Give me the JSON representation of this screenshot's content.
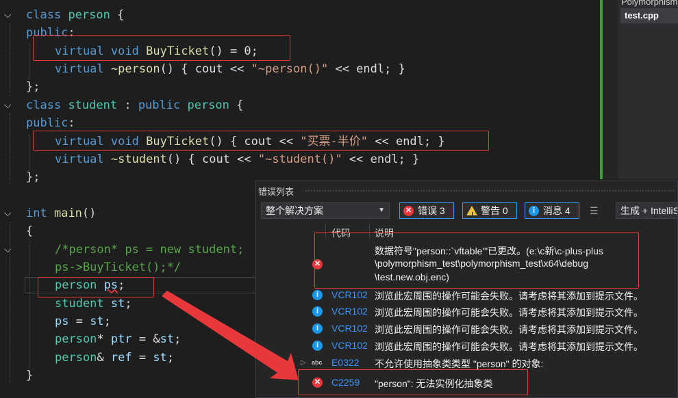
{
  "editor": {
    "lines": {
      "l1": {
        "kw": "class",
        "name": "person",
        "rest": " {"
      },
      "l2": {
        "kw": "public",
        "rest": ":"
      },
      "l3": {
        "virt": "virtual",
        "void": "void",
        "fn": "BuyTicket",
        "rest": "() = 0;"
      },
      "l4": {
        "virt": "virtual",
        "fn": "~person",
        "a": "() { cout << ",
        "str": "\"~person()\"",
        "b": " << endl; }"
      },
      "l5": {
        "rest": "};"
      },
      "l6": {
        "kw": "class",
        "name": "student",
        "a": " : ",
        "pub": "public",
        "base": "person",
        "rest": " {"
      },
      "l7": {
        "kw": "public",
        "rest": ":"
      },
      "l8": {
        "virt": "virtual",
        "void": "void",
        "fn": "BuyTicket",
        "a": "() { cout << ",
        "str": "\"买票-半价\"",
        "b": " << endl; }"
      },
      "l9": {
        "virt": "virtual",
        "fn": "~student",
        "a": "() { cout << ",
        "str": "\"~student()\"",
        "b": " << endl; }"
      },
      "l10": {
        "rest": "};"
      },
      "l11": {
        "kw": "int",
        "fn": "main",
        "rest": "()"
      },
      "l12": {
        "rest": "{"
      },
      "l13": {
        "cm": "/*person* ps = new student;"
      },
      "l14": {
        "cm": "ps->BuyTicket();*/"
      },
      "l15": {
        "ty": "person",
        "var": "ps",
        "rest": ";"
      },
      "l16": {
        "ty": "student",
        "var": "st",
        "rest": ";"
      },
      "l17": {
        "var": "ps",
        "a": " = ",
        "var2": "st",
        "rest": ";"
      },
      "l18": {
        "ty": "person",
        "a": "* ",
        "var": "ptr",
        "b": " = &",
        "var2": "st",
        "rest": ";"
      },
      "l19": {
        "ty": "person",
        "a": "& ",
        "var": "ref",
        "b": " = ",
        "var2": "st",
        "rest": ";"
      },
      "l20": {
        "rest": "}"
      }
    },
    "fold_glyph": "⌵"
  },
  "right_pane": {
    "project": "Polymorphism_test",
    "file": "test.cpp"
  },
  "error_list": {
    "title": "错误列表",
    "scope": "整个解决方案",
    "errors_label": "错误 3",
    "warnings_label": "警告 0",
    "messages_label": "消息 4",
    "build_label": "生成 + IntelliSense",
    "col_code": "代码",
    "col_desc": "说明",
    "rows": [
      {
        "type": "error",
        "code": "",
        "desc1": "数据符号\"person::`vftable'\"已更改。(e:\\c新\\c-plus-plus",
        "desc2": "\\polymorphism_test\\polymorphism_test\\x64\\debug",
        "desc3": "\\test.new.obj.enc)"
      },
      {
        "type": "info",
        "code": "VCR102",
        "desc": "浏览此宏周围的操作可能会失败。请考虑将其添加到提示文件。"
      },
      {
        "type": "info",
        "code": "VCR102",
        "desc": "浏览此宏周围的操作可能会失败。请考虑将其添加到提示文件。"
      },
      {
        "type": "info",
        "code": "VCR102",
        "desc": "浏览此宏周围的操作可能会失败。请考虑将其添加到提示文件。"
      },
      {
        "type": "info",
        "code": "VCR102",
        "desc": "浏览此宏周围的操作可能会失败。请考虑将其添加到提示文件。"
      },
      {
        "type": "abc",
        "code": "E0322",
        "desc": "不允许使用抽象类类型 \"person\" 的对象:"
      },
      {
        "type": "error",
        "code": "C2259",
        "desc": "\"person\": 无法实例化抽象类"
      }
    ]
  },
  "colors": {
    "arrow": "#e8383c",
    "highlight_box": "#e8383c",
    "error_icon": "#e8383c",
    "info_icon": "#1c97ea",
    "warning_icon": "#f0c33c"
  }
}
